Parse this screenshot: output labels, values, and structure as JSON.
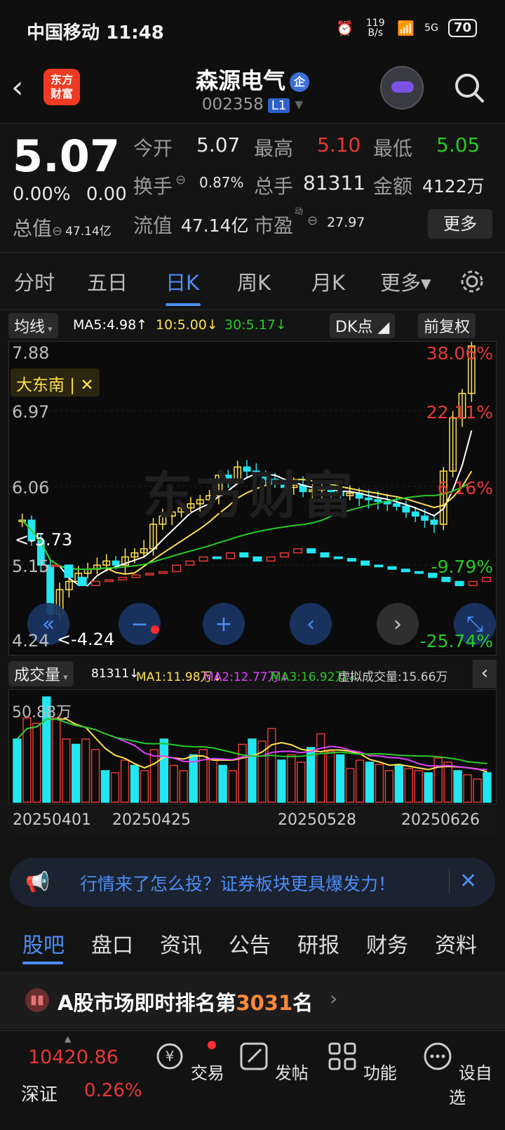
{
  "status_bar": {
    "carrier": "中国移动",
    "time": "11:48",
    "net_speed": "119 B/s",
    "signal": "5G",
    "battery": "70"
  },
  "header": {
    "name": "森源电气",
    "badge": "企",
    "code": "002358",
    "level": "L1"
  },
  "quote": {
    "price": "5.07",
    "change_pct": "0.00%",
    "change": "0.00",
    "total_value_label": "总值",
    "total_value": "47.14亿",
    "open_label": "今开",
    "open": "5.07",
    "high_label": "最高",
    "high": "5.10",
    "low_label": "最低",
    "low": "5.05",
    "turnover_label": "换手",
    "turnover": "0.87%",
    "volume_label": "总手",
    "volume": "81311",
    "amount_label": "金额",
    "amount": "4122万",
    "float_label": "流值",
    "float_value": "47.14亿",
    "pe_label": "市盈",
    "pe_sup": "动",
    "pe": "27.97",
    "more_label": "更多"
  },
  "colors": {
    "red": "#e53935",
    "green": "#27c927",
    "blue": "#4c8df6",
    "yellow": "#ffe14d",
    "cyan": "#22e6f0"
  },
  "tabs": [
    {
      "label": "分时"
    },
    {
      "label": "五日"
    },
    {
      "label": "日K"
    },
    {
      "label": "周K"
    },
    {
      "label": "月K"
    },
    {
      "label": "更多▾"
    }
  ],
  "ma_bar": {
    "mode": "均线",
    "ma5": "MA5:4.98↑",
    "ma10": "10:5.00↓",
    "ma30": "30:5.17↓",
    "dk": "DK点",
    "adjust": "前复权"
  },
  "chart": {
    "axis": [
      "7.88",
      "6.97",
      "6.06",
      "5.15",
      "4.24"
    ],
    "pct_labels": [
      "38.06%",
      "22.11%",
      "6.16%",
      "-9.79%",
      "-25.74%"
    ],
    "tag": "大东南 |",
    "tag_close": "✕",
    "marker_high": "<-5.73",
    "marker_low": "<-4.24",
    "watermark": "东方财富"
  },
  "volume_bar": {
    "title": "成交量",
    "vol": "81311↓",
    "ma1": "MA1:11.98万↓",
    "ma2": "MA2:12.77万↓",
    "ma3": "MA3:16.92万↓",
    "virtual": "虚拟成交量:15.66万",
    "max_label": "50.88万"
  },
  "dates": [
    "20250401",
    "20250425",
    "20250528",
    "20250626"
  ],
  "banner": {
    "text": "行情来了怎么投？证券板块更具爆发力！"
  },
  "bottom_tabs": [
    {
      "label": "股吧"
    },
    {
      "label": "盘口"
    },
    {
      "label": "资讯"
    },
    {
      "label": "公告"
    },
    {
      "label": "研报"
    },
    {
      "label": "财务"
    },
    {
      "label": "资料"
    }
  ],
  "rank": {
    "prefix": "A股市场即时排名第",
    "num": "3031",
    "suffix": "名"
  },
  "nav": {
    "index_value": "10420.86",
    "index_name": "深证",
    "index_pct": "0.26%",
    "items": [
      {
        "label": "交易"
      },
      {
        "label": "发帖"
      },
      {
        "label": "功能"
      },
      {
        "label": "设自选"
      }
    ]
  },
  "chart_data": {
    "type": "candlestick",
    "ylim": [
      4.24,
      7.88
    ],
    "y_ticks": [
      "7.88",
      "6.97",
      "6.06",
      "5.15",
      "4.24"
    ],
    "x_ticks": [
      "20250401",
      "20250425",
      "20250528",
      "20250626"
    ],
    "annotations": [
      "<-5.73",
      "<-4.24"
    ]
  }
}
